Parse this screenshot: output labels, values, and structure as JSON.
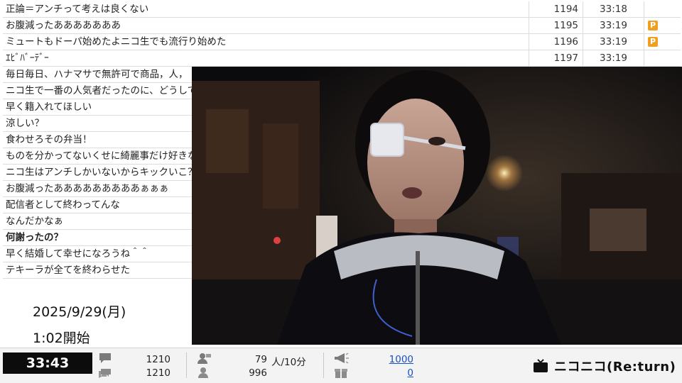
{
  "comments": [
    {
      "text": "正論＝アンチって考えは良くない",
      "num": "1194",
      "time": "33:18",
      "premium": false
    },
    {
      "text": "お腹減ったあああああああ",
      "num": "1195",
      "time": "33:19",
      "premium": true
    },
    {
      "text": "ミュートもドーパ始めたよニコ生でも流行り始めた",
      "num": "1196",
      "time": "33:19",
      "premium": true
    },
    {
      "text": "ｴﾋﾞﾊﾞｰﾃﾞｰ",
      "num": "1197",
      "time": "33:19",
      "premium": false
    },
    {
      "text": "毎日毎日、ハナマサで無許可で商品，人，",
      "num": "",
      "time": "",
      "premium": false
    },
    {
      "text": "ニコ生で一番の人気者だったのに、どうしてこう",
      "num": "",
      "time": "",
      "premium": false
    },
    {
      "text": "早く籍入れてほしい",
      "num": "",
      "time": "",
      "premium": false
    },
    {
      "text": "涼しい？",
      "num": "",
      "time": "",
      "premium": false
    },
    {
      "text": "食わせろその弁当！",
      "num": "",
      "time": "",
      "premium": false
    },
    {
      "text": "ものを分かってないくせに綺麗事だけ好きなの",
      "num": "",
      "time": "",
      "premium": false
    },
    {
      "text": "ニコ生はアンチしかいないからキックいこ？",
      "num": "",
      "time": "",
      "premium": false
    },
    {
      "text": "お腹減ったあああああああああぁぁぁ",
      "num": "",
      "time": "",
      "premium": false
    },
    {
      "text": "配信者として終わってんな",
      "num": "",
      "time": "",
      "premium": false
    },
    {
      "text": "なんだかなぁ",
      "num": "",
      "time": "",
      "premium": false
    },
    {
      "text": "何謝ったの？",
      "num": "",
      "time": "",
      "premium": false,
      "bold": true
    },
    {
      "text": "早く結婚して幸せになろうね＾＾",
      "num": "",
      "time": "",
      "premium": false
    },
    {
      "text": "テキーラが全てを終わらせた",
      "num": "",
      "time": "",
      "premium": false
    }
  ],
  "premium_badge": "P",
  "info": {
    "date": "2025/9/29(月)",
    "start": "1:02開始"
  },
  "bar": {
    "elapsed": "33:43",
    "comments_total": "1210",
    "comments_total2": "1210",
    "viewers_now": "79",
    "viewers_unit": "人/10分",
    "viewers_total": "996",
    "ad_points": "1000",
    "gift_points": "0",
    "logo_text": "ニコニコ(Re:turn)"
  },
  "icons": {
    "comment": "comment-bubble-icon",
    "comments_stack": "comments-stack-icon",
    "viewer": "viewer-person-icon",
    "viewer_total": "viewer-total-icon",
    "ad": "megaphone-icon",
    "gift": "gift-icon",
    "tv": "niconico-tv-icon"
  }
}
